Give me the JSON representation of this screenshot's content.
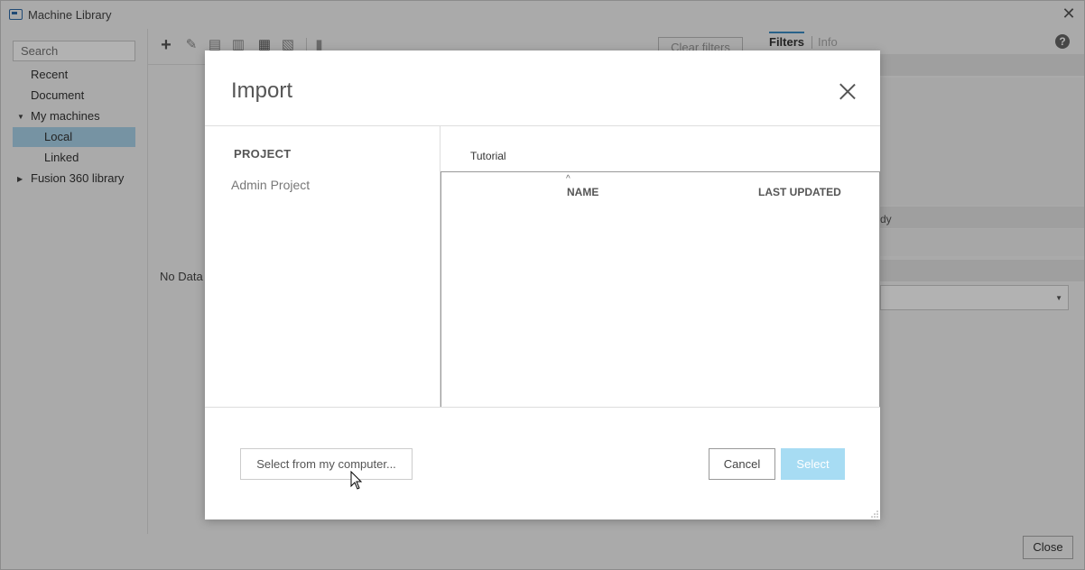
{
  "window": {
    "title": "Machine Library",
    "close_glyph": "✕"
  },
  "sidebar": {
    "search_placeholder": "Search",
    "items": [
      {
        "label": "Recent"
      },
      {
        "label": "Document"
      },
      {
        "label": "My machines"
      },
      {
        "label": "Local"
      },
      {
        "label": "Linked"
      },
      {
        "label": "Fusion 360 library"
      }
    ]
  },
  "toolbar": {
    "clear_filters": "Clear filters"
  },
  "center": {
    "empty_text": "No Data"
  },
  "right_panel": {
    "tabs": [
      {
        "label": "Filters"
      },
      {
        "label": "Info"
      }
    ],
    "help_glyph": "?",
    "partial_text": "dy"
  },
  "footer": {
    "close_label": "Close"
  },
  "dialog": {
    "title": "Import",
    "project_header": "PROJECT",
    "projects": [
      "Admin Project"
    ],
    "folder_tab": "Tutorial",
    "columns": {
      "name": "NAME",
      "last_updated": "LAST UPDATED"
    },
    "sort_glyph": "^",
    "buttons": {
      "from_computer": "Select from my computer...",
      "cancel": "Cancel",
      "select": "Select"
    }
  },
  "colors": {
    "accent": "#3a8dc5",
    "selected_row": "#a9d3ea",
    "select_button": "#a7dcf3"
  }
}
